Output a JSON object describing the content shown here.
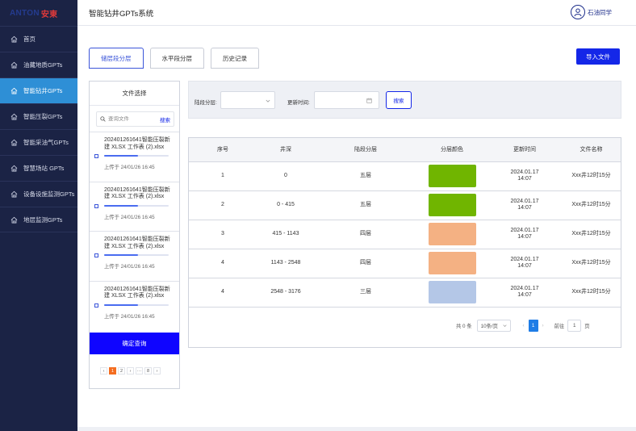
{
  "brand": {
    "logo_en": "ANTON",
    "logo_cn": "安東"
  },
  "app_title": "智能钻井GPTs系统",
  "user": {
    "name": "石油同学"
  },
  "sidebar": {
    "items": [
      {
        "label": "首页"
      },
      {
        "label": "油藏地质GPTs"
      },
      {
        "label": "智能钻井GPTs",
        "active": true
      },
      {
        "label": "智能压裂GPTs"
      },
      {
        "label": "智能采油气GPTs"
      },
      {
        "label": "智慧场站 GPTs"
      },
      {
        "label": "设备设施监测GPTs"
      },
      {
        "label": "地层监测GPTs"
      }
    ]
  },
  "tabs": [
    {
      "label": "储层段分层",
      "active": true
    },
    {
      "label": "水平段分层"
    },
    {
      "label": "历史记录"
    }
  ],
  "toolbar": {
    "import_label": "导入文件"
  },
  "file_panel": {
    "title": "文件选择",
    "search_placeholder": "查询文件",
    "search_label": "搜索",
    "files": [
      {
        "name": "202401261641智能压裂新建 XLSX 工作表 (2).xlsx",
        "uploaded": "上传于 24/01/26 16:45",
        "progress": 0.52
      },
      {
        "name": "202401261641智能压裂新建 XLSX 工作表 (2).xlsx",
        "uploaded": "上传于 24/01/26 16:45",
        "progress": 0.52
      },
      {
        "name": "202401261641智能压裂新建 XLSX 工作表 (2).xlsx",
        "uploaded": "上传于 24/01/26 16:45",
        "progress": 0.52
      },
      {
        "name": "202401261641智能压裂新建 XLSX 工作表 (2).xlsx",
        "uploaded": "上传于 24/01/26 16:45",
        "progress": 0.52
      }
    ],
    "confirm_label": "确定查询",
    "pager": [
      "‹",
      "1",
      "2",
      "›",
      "···",
      "8",
      "›"
    ]
  },
  "filter": {
    "layer_label": "陆段分层:",
    "layer_value": "",
    "time_label": "更新时间:",
    "time_value": "",
    "search_label": "搜索"
  },
  "table": {
    "headers": [
      "序号",
      "井深",
      "陆段分层",
      "分层颜色",
      "更新时间",
      "文件名称"
    ],
    "rows": [
      {
        "no": "1",
        "depth": "0",
        "layer": "五层",
        "color": "#70b500",
        "date": "2024.01.17",
        "time": "14:07",
        "file": "Xxx井12时15分"
      },
      {
        "no": "2",
        "depth": "0 - 415",
        "layer": "五层",
        "color": "#70b500",
        "date": "2024.01.17",
        "time": "14:07",
        "file": "Xxx井12时15分"
      },
      {
        "no": "3",
        "depth": "415 - 1143",
        "layer": "四层",
        "color": "#f4b183",
        "date": "2024.01.17",
        "time": "14:07",
        "file": "Xxx井12时15分"
      },
      {
        "no": "4",
        "depth": "1143 - 2548",
        "layer": "四层",
        "color": "#f4b183",
        "date": "2024.01.17",
        "time": "14:07",
        "file": "Xxx井12时15分"
      },
      {
        "no": "4",
        "depth": "2548 - 3176",
        "layer": "三层",
        "color": "#b4c7e7",
        "date": "2024.01.17",
        "time": "14:07",
        "file": "Xxx井12时15分"
      }
    ]
  },
  "pagination": {
    "total": "共 0 条",
    "page_size": "10条/页",
    "prev": "‹",
    "current": "1",
    "next": "›",
    "goto_label": "前往",
    "goto_value": "1",
    "page_unit": "页"
  },
  "colors": {
    "sidebar": "#1b2345",
    "active_nav": "#2e8fd6",
    "primary": "#1427e8",
    "confirm": "#0f05ff"
  }
}
